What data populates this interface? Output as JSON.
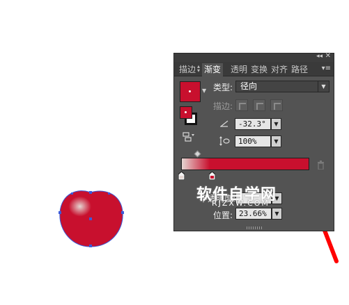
{
  "panel": {
    "tabs": [
      {
        "label": "描边",
        "active": false
      },
      {
        "label": "渐变",
        "active": true
      },
      {
        "label": "透明",
        "active": false
      },
      {
        "label": "变换",
        "active": false
      },
      {
        "label": "对齐",
        "active": false
      },
      {
        "label": "路径",
        "active": false
      }
    ],
    "type_label": "类型:",
    "type_value": "径向",
    "stroke_label": "描边:",
    "angle_value": "-32.3°",
    "aspect_value": "100%",
    "opacity_label": "不透明度:",
    "location_label": "位置:",
    "location_value": "23.66%"
  },
  "colors": {
    "gradient_start": "#e5d6d2",
    "gradient_end": "#c8102e",
    "accent_red": "#c8102e",
    "annotation_arrow": "#ff0000",
    "selection_blue": "#3b5bd9"
  },
  "watermark": {
    "title": "软件自学网",
    "subtitle": "RJZXW.COM"
  }
}
